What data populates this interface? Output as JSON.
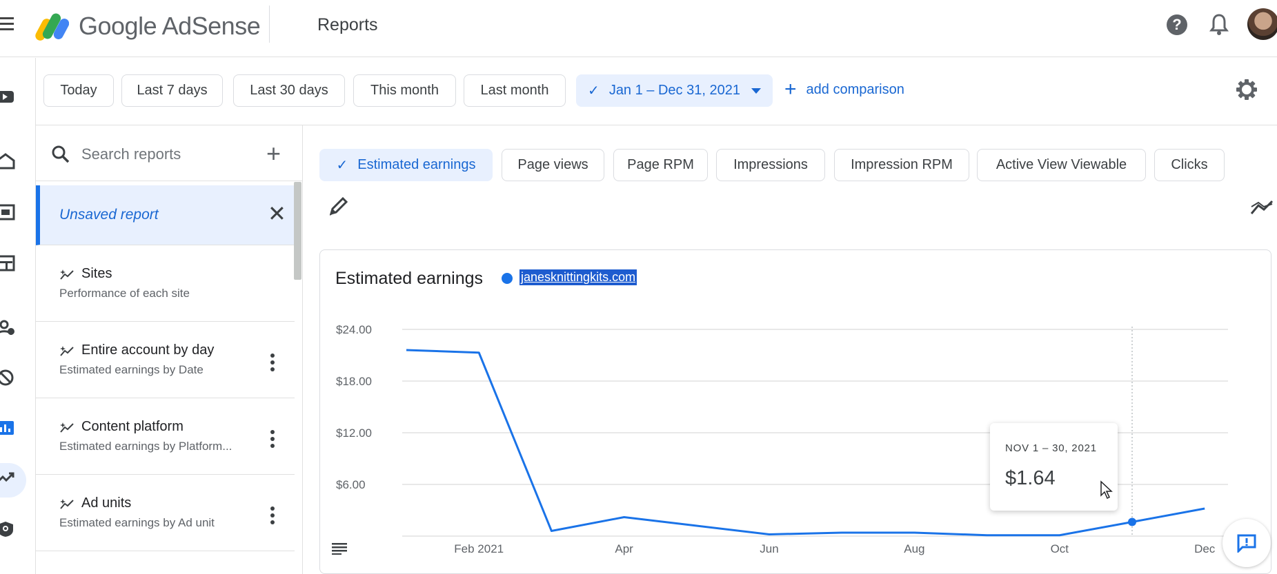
{
  "header": {
    "brand": "Google AdSense",
    "page_title": "Reports",
    "icons": [
      "menu-icon",
      "adsense-logo",
      "help-icon",
      "notifications-icon",
      "avatar"
    ]
  },
  "rail": {
    "icons": [
      "youtube-icon",
      "home-icon",
      "ads-icon",
      "sites-icon",
      "privacy-messaging-icon",
      "brand-safety-icon",
      "reports-icon",
      "optimization-icon",
      "account-icon"
    ],
    "active": "reports-icon"
  },
  "date_filters": {
    "chips": [
      "Today",
      "Last 7 days",
      "Last 30 days",
      "This month",
      "Last month"
    ],
    "selected_range": "Jan 1 – Dec 31, 2021",
    "add_comparison": "add comparison"
  },
  "reports_panel": {
    "search_placeholder": "Search reports",
    "unsaved_report": "Unsaved report",
    "items": [
      {
        "title": "Sites",
        "subtitle": "Performance of each site"
      },
      {
        "title": "Entire account by day",
        "subtitle": "Estimated earnings by Date"
      },
      {
        "title": "Content platform",
        "subtitle": "Estimated earnings by Platform..."
      },
      {
        "title": "Ad units",
        "subtitle": "Estimated earnings by Ad unit"
      }
    ]
  },
  "metrics": {
    "active": "Estimated earnings",
    "others": [
      "Page views",
      "Page RPM",
      "Impressions",
      "Impression RPM",
      "Active View Viewable",
      "Clicks"
    ]
  },
  "chart": {
    "title": "Estimated earnings",
    "legend_site": "janesknittingkits.com",
    "tooltip_date": "NOV 1 – 30, 2021",
    "tooltip_value": "$1.64"
  },
  "colors": {
    "accent": "#1a73e8",
    "active_bg": "#e8f0fe",
    "link": "#1967d2"
  },
  "chart_data": {
    "type": "line",
    "title": "Estimated earnings",
    "x": [
      "Jan 2021",
      "Feb 2021",
      "Mar 2021",
      "Apr 2021",
      "May 2021",
      "Jun 2021",
      "Jul 2021",
      "Aug 2021",
      "Sep 2021",
      "Oct 2021",
      "Nov 2021",
      "Dec 2021"
    ],
    "x_tick_labels": [
      "Feb 2021",
      "Apr",
      "Jun",
      "Aug",
      "Oct",
      "Dec"
    ],
    "y_tick_labels": [
      "$6.00",
      "$12.00",
      "$18.00",
      "$24.00"
    ],
    "series": [
      {
        "name": "janesknittingkits.com",
        "values": [
          21.6,
          21.3,
          0.6,
          2.2,
          1.2,
          0.2,
          0.4,
          0.4,
          0.1,
          0.1,
          1.64,
          3.2
        ]
      }
    ],
    "ylim": [
      0,
      24
    ],
    "grid": true,
    "highlighted_point": "Nov 2021"
  }
}
